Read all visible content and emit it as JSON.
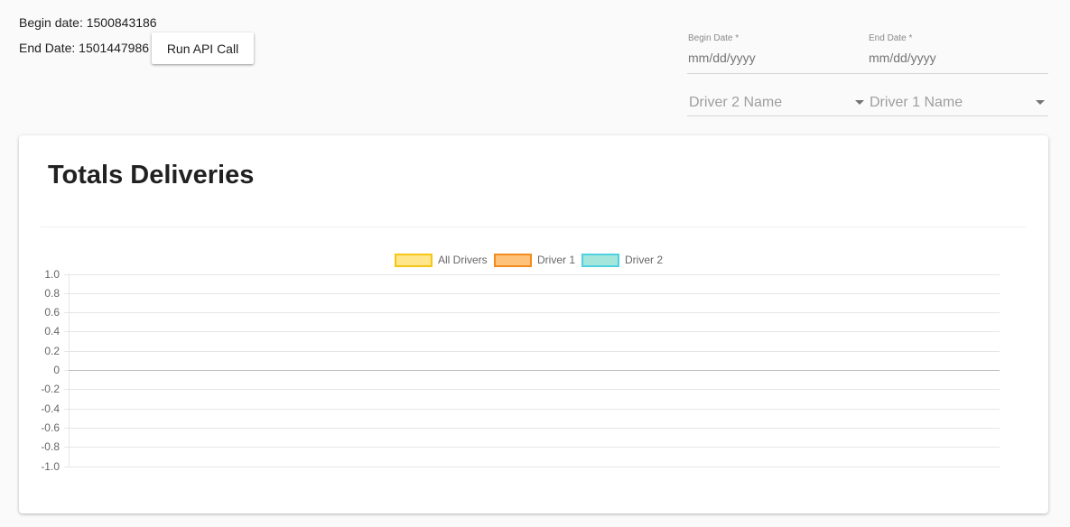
{
  "header": {
    "begin_label": "Begin date: 1500843186",
    "end_label": "End Date: 1501447986",
    "run_button_label": "Run API Call"
  },
  "filters": {
    "begin_date": {
      "label": "Begin Date *",
      "placeholder": "mm/dd/yyyy"
    },
    "end_date": {
      "label": "End Date *",
      "placeholder": "mm/dd/yyyy"
    },
    "driver2_select": {
      "placeholder": "Driver 2 Name"
    },
    "driver1_select": {
      "placeholder": "Driver 1 Name"
    }
  },
  "card": {
    "title": "Totals Deliveries"
  },
  "chart_data": {
    "type": "bar",
    "title": "",
    "xlabel": "",
    "ylabel": "",
    "ylim": [
      -1.0,
      1.0
    ],
    "y_ticks": [
      "1.0",
      "0.8",
      "0.6",
      "0.4",
      "0.2",
      "0",
      "-0.2",
      "-0.4",
      "-0.6",
      "-0.8",
      "-1.0"
    ],
    "grid": true,
    "legend_position": "top",
    "categories": [],
    "series": [
      {
        "name": "All Drivers",
        "values": [],
        "fill": "#ffe68a",
        "border": "#f5c518"
      },
      {
        "name": "Driver 1",
        "values": [],
        "fill": "#ffc27a",
        "border": "#f28c1e"
      },
      {
        "name": "Driver 2",
        "values": [],
        "fill": "#a4e5dc",
        "border": "#4fd0e0"
      }
    ]
  }
}
